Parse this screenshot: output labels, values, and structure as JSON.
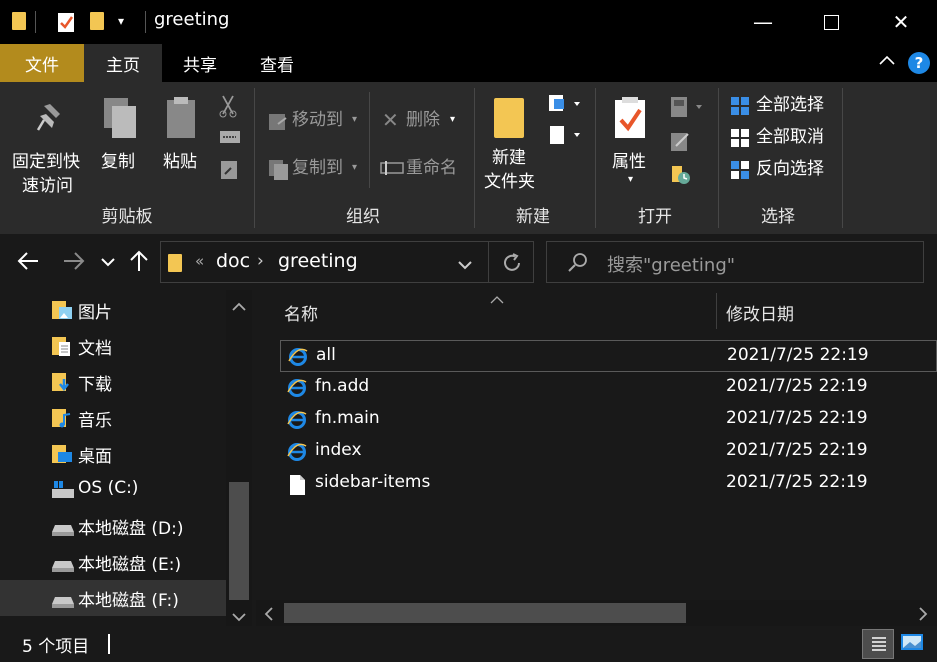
{
  "window": {
    "title": "greeting",
    "minimize": "—",
    "maximize": "☐",
    "close": "✕"
  },
  "tabs": {
    "file": "文件",
    "home": "主页",
    "share": "共享",
    "view": "查看"
  },
  "ribbon": {
    "pin_line1": "固定到快",
    "pin_line2": "速访问",
    "copy": "复制",
    "paste": "粘贴",
    "move_to": "移动到",
    "copy_to": "复制到",
    "delete": "删除",
    "rename": "重命名",
    "new_folder_line1": "新建",
    "new_folder_line2": "文件夹",
    "properties": "属性",
    "select_all": "全部选择",
    "select_none": "全部取消",
    "invert_selection": "反向选择",
    "groups": {
      "clipboard": "剪贴板",
      "organize": "组织",
      "new": "新建",
      "open": "打开",
      "select": "选择"
    }
  },
  "address": {
    "overflow": "«",
    "path": [
      "doc",
      "greeting"
    ],
    "separator": "›"
  },
  "search": {
    "placeholder": "搜索\"greeting\""
  },
  "sidebar": {
    "items": [
      {
        "label": "图片",
        "icon": "pictures-icon"
      },
      {
        "label": "文档",
        "icon": "documents-icon"
      },
      {
        "label": "下载",
        "icon": "downloads-icon"
      },
      {
        "label": "音乐",
        "icon": "music-icon"
      },
      {
        "label": "桌面",
        "icon": "desktop-icon"
      },
      {
        "label": "OS (C:)",
        "icon": "os-drive-icon"
      },
      {
        "label": "本地磁盘 (D:)",
        "icon": "drive-icon"
      },
      {
        "label": "本地磁盘 (E:)",
        "icon": "drive-icon"
      },
      {
        "label": "本地磁盘 (F:)",
        "icon": "drive-icon"
      }
    ],
    "selected_index": 8
  },
  "columns": {
    "name": "名称",
    "date": "修改日期"
  },
  "files": [
    {
      "name": "all",
      "date": "2021/7/25 22:19",
      "icon": "ie-html-icon"
    },
    {
      "name": "fn.add",
      "date": "2021/7/25 22:19",
      "icon": "ie-html-icon"
    },
    {
      "name": "fn.main",
      "date": "2021/7/25 22:19",
      "icon": "ie-html-icon"
    },
    {
      "name": "index",
      "date": "2021/7/25 22:19",
      "icon": "ie-html-icon"
    },
    {
      "name": "sidebar-items",
      "date": "2021/7/25 22:19",
      "icon": "blank-file-icon"
    }
  ],
  "status": {
    "count": "5 个项目"
  },
  "colors": {
    "file_tab": "#b38b1d",
    "background": "#191919",
    "ribbon": "#2b2b2b",
    "folder": "#f3c653",
    "help": "#1e88e5"
  }
}
